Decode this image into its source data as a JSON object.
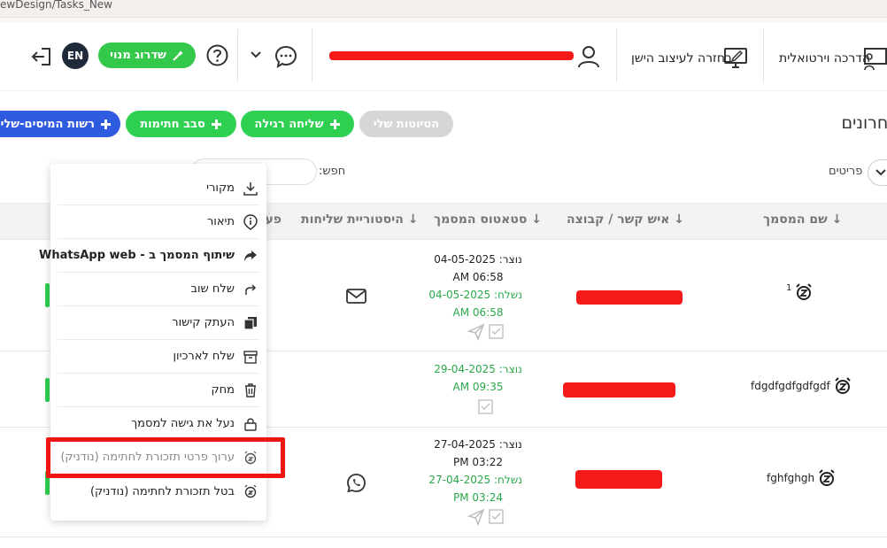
{
  "browser": {
    "url_fragment": "ewDesign/Tasks_New"
  },
  "header": {
    "virtual_guide": "הדרכה וירטואלית",
    "session_design": "בחזרה לעיצוב הישן",
    "upgrade_label": "שדרוג מנוי",
    "lang_badge": "EN"
  },
  "toolbar": {
    "title": "אחרונים",
    "drafts_label": "הטיוטות שלי",
    "regular_send_label": "שליחה רגילה",
    "signing_round_label": "סבב חתימות",
    "task_list_label": "רשות המיסים-שליחה"
  },
  "filters": {
    "search_label": "חפש:",
    "items_label": "פריטים"
  },
  "table": {
    "headers": {
      "doc_name": "שם המסמך",
      "contact": "איש קשר / קבוצה",
      "status": "סטאטוס המסמך",
      "history": "היסטוריית שליחות",
      "actions": "פעולות"
    },
    "rows": [
      {
        "name": "1",
        "created": "נוצר: 04-05-2025",
        "created_time": "AM 06:58",
        "sent": "נשלח: 04-05-2025",
        "sent_time": "AM 06:58",
        "history_icon": "envelope-icon"
      },
      {
        "name": "fdgdfgdfgdfgdf",
        "created": "נוצר: 29-04-2025",
        "created_time": "AM 09:35",
        "sent": "",
        "sent_time": "",
        "history_icon": ""
      },
      {
        "name": "fghfghgh",
        "created": "נוצר: 27-04-2025",
        "created_time": "PM 03:22",
        "sent": "נשלח: 27-04-2025",
        "sent_time": "PM 03:24",
        "history_icon": "whatsapp-icon"
      }
    ]
  },
  "menu": {
    "items": [
      {
        "label": "מקורי",
        "icon": "download-icon"
      },
      {
        "label": "תיאור",
        "icon": "info-icon"
      },
      {
        "label": "שיתוף המסמך ב - WhatsApp web",
        "icon": "share-icon"
      },
      {
        "label": "שלח שוב",
        "icon": "resend-icon"
      },
      {
        "label": "העתק קישור",
        "icon": "copy-icon"
      },
      {
        "label": "שלח לארכיון",
        "icon": "archive-icon"
      },
      {
        "label": "מחק",
        "icon": "trash-icon"
      },
      {
        "label": "נעל את גישה למסמך",
        "icon": "lock-icon"
      },
      {
        "label": "ערוך פרטי תזכורת לחתימה (נודניק)",
        "icon": "alarm-icon"
      },
      {
        "label": "בטל תזכורת לחתימה (נודניק)",
        "icon": "alarm-icon"
      }
    ]
  },
  "colors": {
    "green": "#2fcf52",
    "blue": "#2f5be0",
    "gray_pill": "#d4d4d4",
    "redaction": "#f71a1a"
  }
}
